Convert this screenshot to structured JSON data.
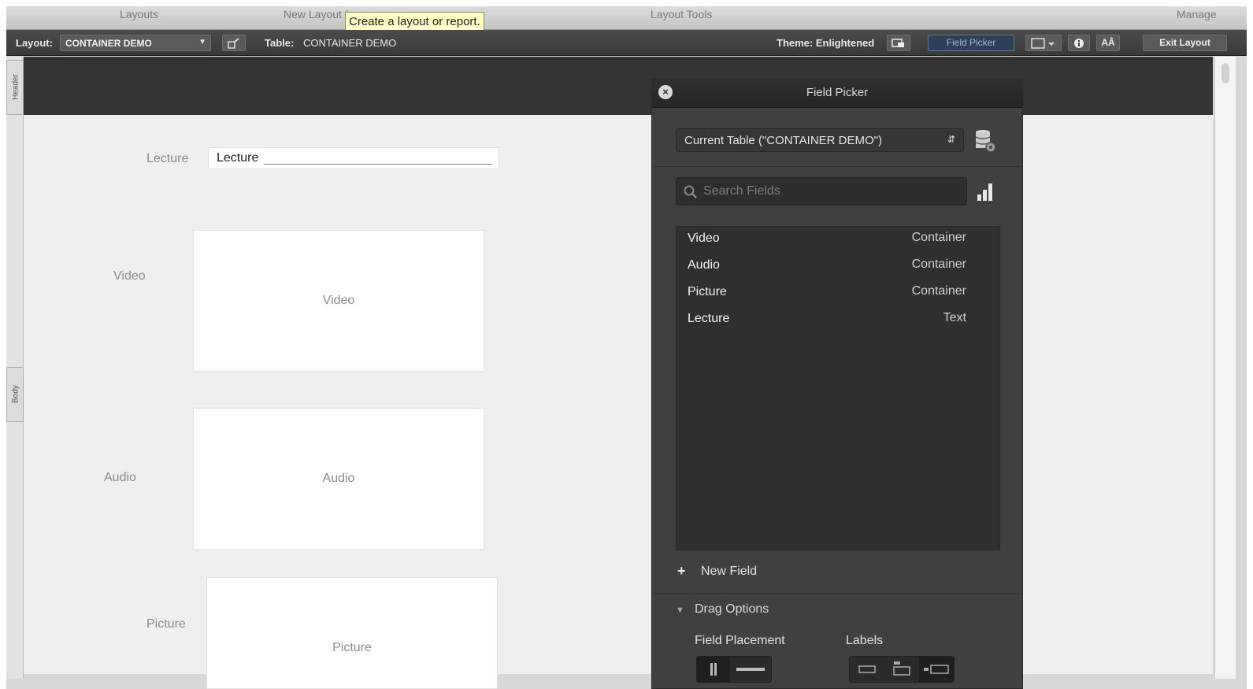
{
  "menu": {
    "layouts": "Layouts",
    "new_layout": "New Layout / Report",
    "layout_tools": "Layout Tools",
    "manage": "Manage"
  },
  "tooltip": "Create a layout or report.",
  "toolbar": {
    "layout_label": "Layout:",
    "layout_value": "CONTAINER DEMO",
    "table_label": "Table:",
    "table_value": "CONTAINER DEMO",
    "theme_label": "Theme: Enlightened",
    "field_picker_label": "Field Picker",
    "aa_label": "AÂ",
    "exit_label": "Exit Layout"
  },
  "parts": {
    "header": "Header",
    "body": "Body"
  },
  "layout_fields": {
    "lecture": {
      "label": "Lecture",
      "content": "Lecture"
    },
    "video": {
      "label": "Video",
      "content": "Video"
    },
    "audio": {
      "label": "Audio",
      "content": "Audio"
    },
    "picture": {
      "label": "Picture",
      "content": "Picture"
    }
  },
  "field_picker": {
    "title": "Field Picker",
    "table_select": "Current Table (\"CONTAINER DEMO\")",
    "search_placeholder": "Search Fields",
    "fields": [
      {
        "name": "Video",
        "type": "Container"
      },
      {
        "name": "Audio",
        "type": "Container"
      },
      {
        "name": "Picture",
        "type": "Container"
      },
      {
        "name": "Lecture",
        "type": "Text"
      }
    ],
    "new_field": "New Field",
    "drag_options": "Drag Options",
    "field_placement": "Field Placement",
    "labels": "Labels"
  }
}
